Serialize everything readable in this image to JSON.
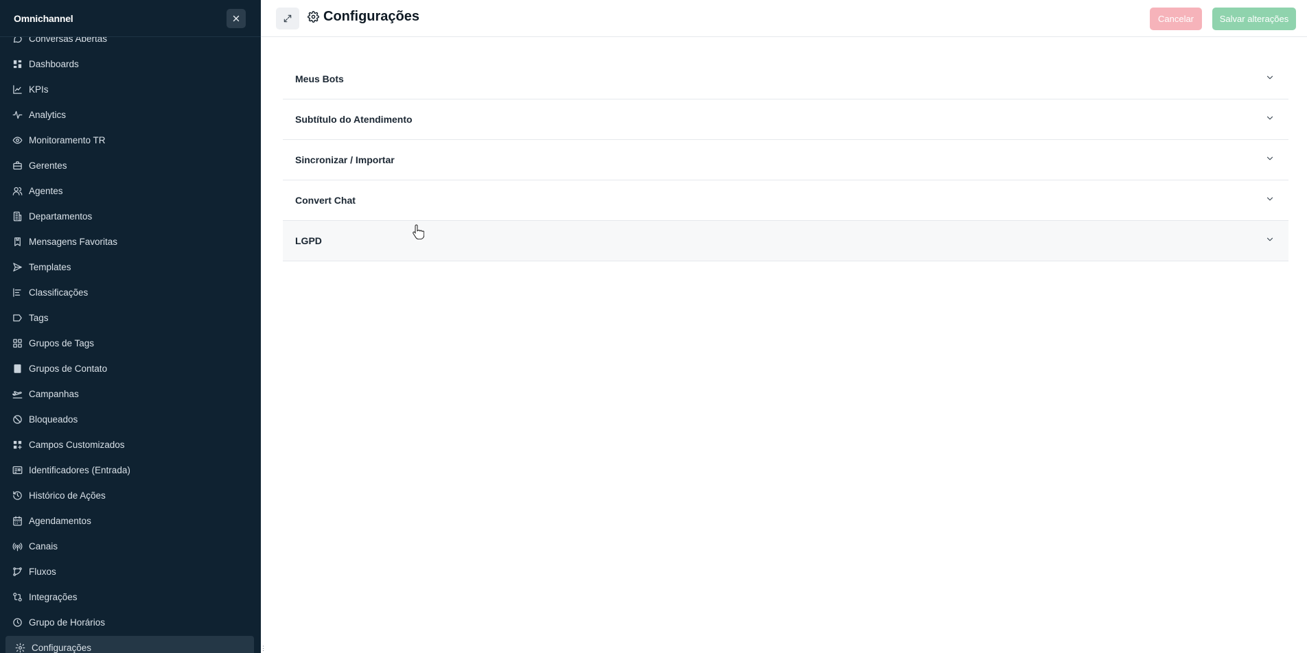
{
  "sidebar": {
    "brand": "Omnichannel",
    "items": [
      {
        "label": "Conversas Abertas",
        "icon": "chat-icon",
        "name": "sidebar-item-conversas-abertas"
      },
      {
        "label": "Dashboards",
        "icon": "dashboard-grid-icon",
        "name": "sidebar-item-dashboards"
      },
      {
        "label": "KPIs",
        "icon": "line-chart-icon",
        "name": "sidebar-item-kpis"
      },
      {
        "label": "Analytics",
        "icon": "activity-icon",
        "name": "sidebar-item-analytics"
      },
      {
        "label": "Monitoramento TR",
        "icon": "eye-icon",
        "name": "sidebar-item-monitoramento-tr"
      },
      {
        "label": "Gerentes",
        "icon": "briefcase-icon",
        "name": "sidebar-item-gerentes"
      },
      {
        "label": "Agentes",
        "icon": "users-icon",
        "name": "sidebar-item-agentes"
      },
      {
        "label": "Departamentos",
        "icon": "building-icon",
        "name": "sidebar-item-departamentos"
      },
      {
        "label": "Mensagens Favoritas",
        "icon": "bookmark-icon",
        "name": "sidebar-item-mensagens-favoritas"
      },
      {
        "label": "Templates",
        "icon": "send-icon",
        "name": "sidebar-item-templates"
      },
      {
        "label": "Classificações",
        "icon": "align-bars-icon",
        "name": "sidebar-item-classificacoes"
      },
      {
        "label": "Tags",
        "icon": "tag-icon",
        "name": "sidebar-item-tags"
      },
      {
        "label": "Grupos de Tags",
        "icon": "grid-icon",
        "name": "sidebar-item-grupos-de-tags"
      },
      {
        "label": "Grupos de Contato",
        "icon": "contact-book-icon",
        "name": "sidebar-item-grupos-de-contato"
      },
      {
        "label": "Campanhas",
        "icon": "plane-takeoff-icon",
        "name": "sidebar-item-campanhas"
      },
      {
        "label": "Bloqueados",
        "icon": "ban-icon",
        "name": "sidebar-item-bloqueados"
      },
      {
        "label": "Campos Customizados",
        "icon": "grid-plus-icon",
        "name": "sidebar-item-campos-customizados"
      },
      {
        "label": "Identificadores (Entrada)",
        "icon": "id-card-icon",
        "name": "sidebar-item-identificadores"
      },
      {
        "label": "Histórico de Ações",
        "icon": "history-icon",
        "name": "sidebar-item-historico-de-acoes"
      },
      {
        "label": "Agendamentos",
        "icon": "calendar-icon",
        "name": "sidebar-item-agendamentos"
      },
      {
        "label": "Canais",
        "icon": "radio-tower-icon",
        "name": "sidebar-item-canais"
      },
      {
        "label": "Fluxos",
        "icon": "workflow-icon",
        "name": "sidebar-item-fluxos"
      },
      {
        "label": "Integrações",
        "icon": "git-compare-icon",
        "name": "sidebar-item-integracoes"
      },
      {
        "label": "Grupo de Horários",
        "icon": "clock-icon",
        "name": "sidebar-item-grupo-de-horarios"
      },
      {
        "label": "Configurações",
        "icon": "gear-icon",
        "name": "sidebar-item-configuracoes",
        "active": true
      }
    ]
  },
  "header": {
    "title": "Configurações",
    "cancel_label": "Cancelar",
    "save_label": "Salvar alterações"
  },
  "sections": [
    {
      "label": "Meus Bots"
    },
    {
      "label": "Subtítulo do Atendimento"
    },
    {
      "label": "Sincronizar / Importar"
    },
    {
      "label": "Convert Chat"
    },
    {
      "label": "LGPD"
    }
  ],
  "colors": {
    "sidebar_bg": "#0f2231",
    "cancel_bg": "#f6b3ba",
    "save_bg": "#8fd3ad"
  }
}
